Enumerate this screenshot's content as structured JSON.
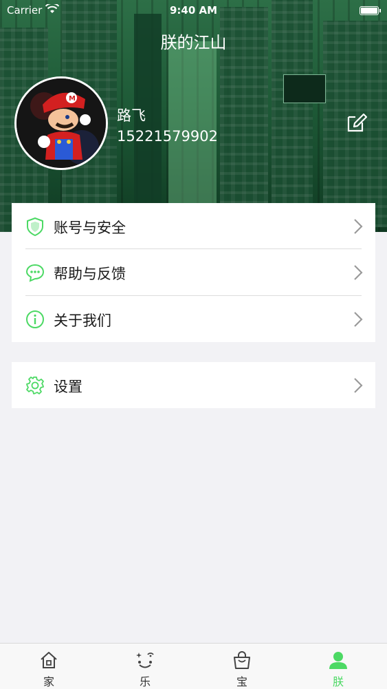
{
  "status_bar": {
    "carrier": "Carrier",
    "time": "9:40 AM"
  },
  "header": {
    "title": "朕的江山"
  },
  "profile": {
    "name": "路飞",
    "phone": "15221579902"
  },
  "menu_group_1": [
    {
      "label": "账号与安全",
      "icon": "shield-icon"
    },
    {
      "label": "帮助与反馈",
      "icon": "chat-bubble-icon"
    },
    {
      "label": "关于我们",
      "icon": "info-icon"
    }
  ],
  "menu_group_2": [
    {
      "label": "设置",
      "icon": "gear-icon"
    }
  ],
  "tabs": [
    {
      "label": "家",
      "icon": "home-icon"
    },
    {
      "label": "乐",
      "icon": "fun-face-icon"
    },
    {
      "label": "宝",
      "icon": "shopping-bag-icon"
    },
    {
      "label": "朕",
      "icon": "person-icon",
      "active": true
    }
  ],
  "colors": {
    "accent": "#4cd964",
    "banner": "#1e5a37",
    "background": "#f2f2f5"
  }
}
